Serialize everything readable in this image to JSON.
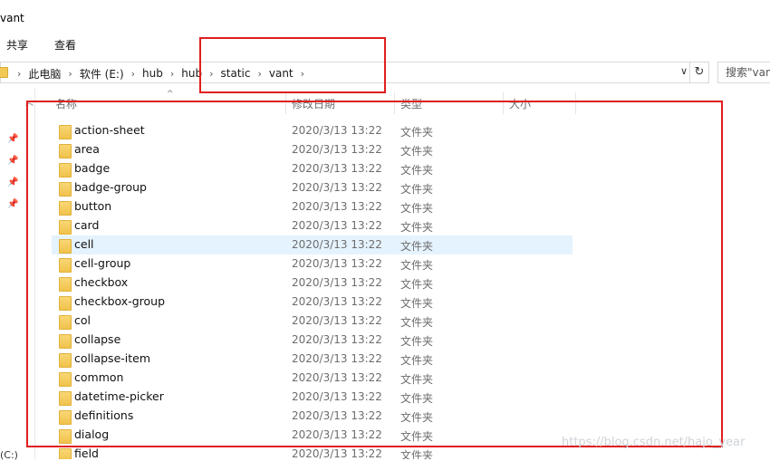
{
  "window": {
    "title": "vant"
  },
  "ribbon": {
    "tabs": [
      "共享",
      "查看"
    ]
  },
  "address": {
    "segments": [
      "此电脑",
      "软件 (E:)",
      "hub",
      "hub",
      "static",
      "vant"
    ],
    "dropdown_glyph": "∨",
    "refresh_glyph": "↻"
  },
  "search": {
    "placeholder": "搜索\"vant\""
  },
  "columns": {
    "name": "名称",
    "date": "修改日期",
    "type": "类型",
    "size": "大小"
  },
  "files": [
    {
      "name": "action-sheet",
      "date": "2020/3/13 13:22",
      "type": "文件夹"
    },
    {
      "name": "area",
      "date": "2020/3/13 13:22",
      "type": "文件夹"
    },
    {
      "name": "badge",
      "date": "2020/3/13 13:22",
      "type": "文件夹"
    },
    {
      "name": "badge-group",
      "date": "2020/3/13 13:22",
      "type": "文件夹"
    },
    {
      "name": "button",
      "date": "2020/3/13 13:22",
      "type": "文件夹"
    },
    {
      "name": "card",
      "date": "2020/3/13 13:22",
      "type": "文件夹"
    },
    {
      "name": "cell",
      "date": "2020/3/13 13:22",
      "type": "文件夹",
      "selected": true
    },
    {
      "name": "cell-group",
      "date": "2020/3/13 13:22",
      "type": "文件夹"
    },
    {
      "name": "checkbox",
      "date": "2020/3/13 13:22",
      "type": "文件夹"
    },
    {
      "name": "checkbox-group",
      "date": "2020/3/13 13:22",
      "type": "文件夹"
    },
    {
      "name": "col",
      "date": "2020/3/13 13:22",
      "type": "文件夹"
    },
    {
      "name": "collapse",
      "date": "2020/3/13 13:22",
      "type": "文件夹"
    },
    {
      "name": "collapse-item",
      "date": "2020/3/13 13:22",
      "type": "文件夹"
    },
    {
      "name": "common",
      "date": "2020/3/13 13:22",
      "type": "文件夹"
    },
    {
      "name": "datetime-picker",
      "date": "2020/3/13 13:22",
      "type": "文件夹"
    },
    {
      "name": "definitions",
      "date": "2020/3/13 13:22",
      "type": "文件夹"
    },
    {
      "name": "dialog",
      "date": "2020/3/13 13:22",
      "type": "文件夹"
    },
    {
      "name": "field",
      "date": "2020/3/13 13:22",
      "type": "文件夹"
    }
  ],
  "navpane": {
    "bottom_label": "(C:)"
  },
  "watermark": "https://blog.csdn.net/hajo_year",
  "colors": {
    "annotation": "#e01e1e",
    "selected_row": "#e5f3ff",
    "folder": "#f3c955"
  },
  "icons": [
    "folder-icon",
    "pin-icon",
    "refresh-icon",
    "chevron-down-icon",
    "chevron-right-icon"
  ]
}
